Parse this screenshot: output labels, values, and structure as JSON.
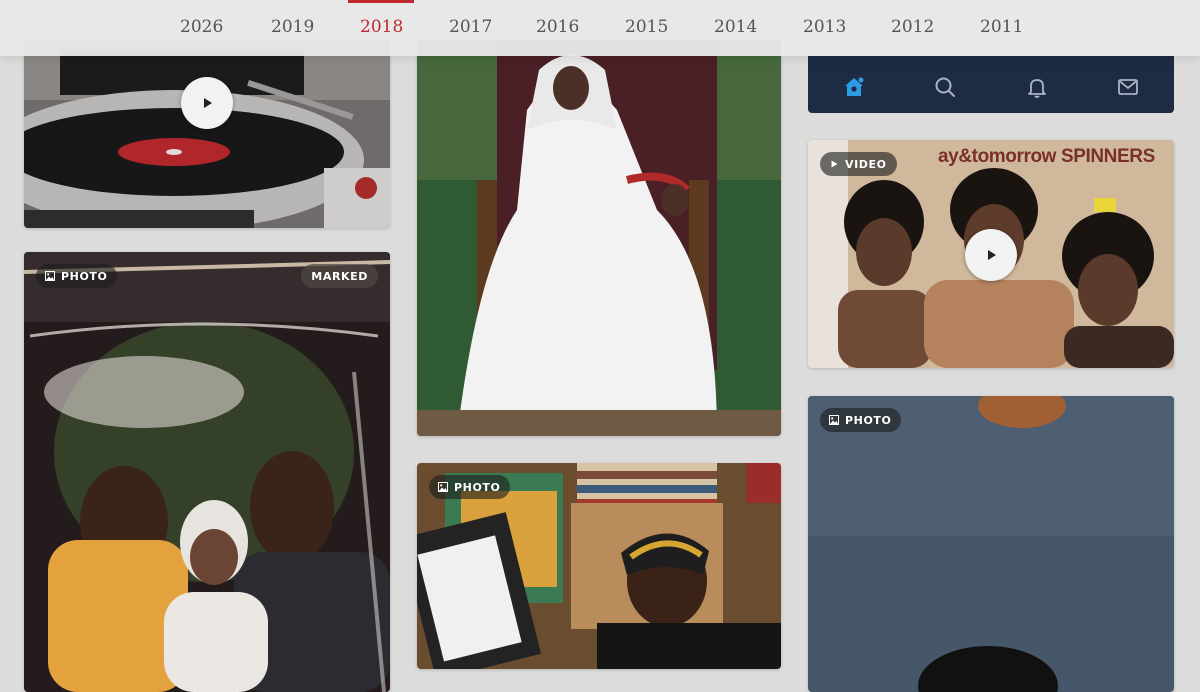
{
  "year_nav": {
    "years": [
      "2026",
      "2019",
      "2018",
      "2017",
      "2016",
      "2015",
      "2014",
      "2013",
      "2012",
      "2011"
    ],
    "active": "2018"
  },
  "colors": {
    "accent": "#c0292d",
    "page_background": "#dcdcdc",
    "app_nav_background": "#1d2b45",
    "app_nav_active_icon": "#2f9ae6"
  },
  "app_nav": {
    "icons": [
      "home-icon",
      "search-icon",
      "bell-icon",
      "mail-icon"
    ],
    "active": "home-icon"
  },
  "cards": {
    "record_player": {
      "type": "video",
      "icon": "play-icon"
    },
    "family_photo": {
      "badge": "PHOTO",
      "marked": "MARKED"
    },
    "woman_portrait": {
      "type": "photo"
    },
    "spinners_video": {
      "badge": "VIDEO",
      "album_text": "ay&tomorrow SPINNERS",
      "icon": "play-icon"
    },
    "records_photo": {
      "badge": "PHOTO"
    },
    "blue_portrait": {
      "badge": "PHOTO"
    }
  }
}
